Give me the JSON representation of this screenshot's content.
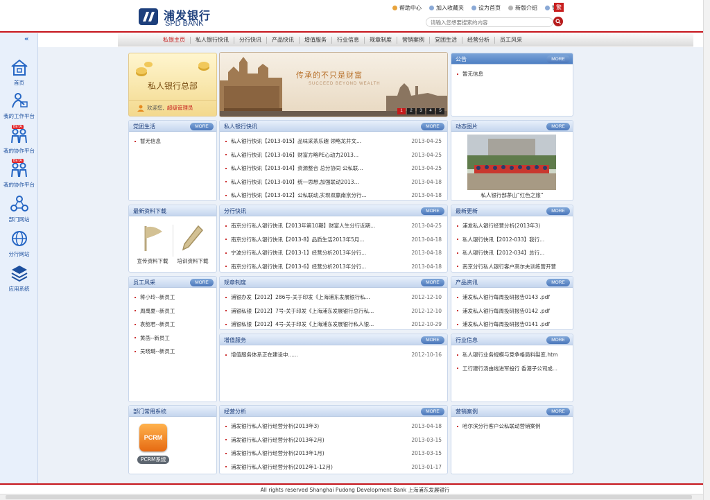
{
  "header": {
    "logo_cn": "浦发银行",
    "logo_en": "SPD BANK",
    "links": [
      "帮助中心",
      "加入收藏夹",
      "设为首页",
      "新版介绍",
      "管理"
    ],
    "lang_toggle": "繁",
    "search_placeholder": "请输入您想要搜索的内容"
  },
  "nav": {
    "items": [
      "私银主页",
      "私人银行快讯",
      "分行快讯",
      "产品快讯",
      "增值服务",
      "行业信息",
      "规章制度",
      "营销案例",
      "党团生活",
      "经营分析",
      "员工风采"
    ],
    "active": "私银主页"
  },
  "sidebar": {
    "items": [
      {
        "label": "首页",
        "icon": "home-icon"
      },
      {
        "label": "我的工作平台",
        "icon": "workspace-icon"
      },
      {
        "label": "我的协作平台",
        "icon": "collab-icon",
        "badge": "BETA"
      },
      {
        "label": "我的协作平台",
        "icon": "collab-icon",
        "badge": "BETA"
      },
      {
        "label": "部门网站",
        "icon": "network-icon"
      },
      {
        "label": "分行网站",
        "icon": "globe-icon"
      },
      {
        "label": "应用系统",
        "icon": "layers-icon"
      }
    ]
  },
  "welcome": {
    "title": "私人银行总部",
    "greeting": "欢迎您,",
    "user": "超级管理员"
  },
  "banner": {
    "slogan": "传承的不只是财富",
    "slogan_en": "SUCCEED  BEYOND  WEALTH",
    "pages": [
      "1",
      "2",
      "3",
      "4",
      "5"
    ],
    "active_page": "1"
  },
  "more_label": "MORE",
  "announcements": {
    "title": "公告",
    "items": [
      "暂无信息"
    ]
  },
  "party": {
    "title": "党团生活",
    "items": [
      "暂无信息"
    ]
  },
  "private_news": {
    "title": "私人银行快讯",
    "items": [
      {
        "text": "私人银行快讯【2013-015】品味采茶乐趣 领略龙井文...",
        "date": "2013-04-25"
      },
      {
        "text": "私人银行快讯【2013-016】财富方略PE心动力2013...",
        "date": "2013-04-25"
      },
      {
        "text": "私人银行快讯【2013-014】资源整合 总分协同 公私联...",
        "date": "2013-04-25"
      },
      {
        "text": "私人银行快讯【2013-010】统一思想,加强联动2013...",
        "date": "2013-04-18"
      },
      {
        "text": "私人银行快讯【2013-012】公私联动,实现双赢南京分行...",
        "date": "2013-04-18"
      }
    ]
  },
  "photos": {
    "title": "动态图片",
    "caption": "私人银行部茅山“红色之旅”"
  },
  "downloads": {
    "title": "最新资料下载",
    "items": [
      "宣传资料下载",
      "培训资料下载"
    ]
  },
  "branch_news": {
    "title": "分行快讯",
    "items": [
      {
        "text": "南京分行私人银行快讯【2013年第10期】财富人生分行近期...",
        "date": "2013-04-25"
      },
      {
        "text": "南京分行私人银行快讯【2013-8】品质生活2013年5月...",
        "date": "2013-04-18"
      },
      {
        "text": "宁波分行私人银行快讯【2013-1】经营分析2013年分行...",
        "date": "2013-04-18"
      },
      {
        "text": "南京分行私人银行快讯【2013-6】经营分析2013年分行...",
        "date": "2013-04-18"
      }
    ]
  },
  "updates": {
    "title": "最新更新",
    "items": [
      "浦发私人银行经营分析(2013年3)",
      "私人银行快讯【2012-033】我行...",
      "私人银行快讯【2012-034】总行...",
      "南京分行私人银行客户高尔夫训练营开营"
    ]
  },
  "staff": {
    "title": "员工风采",
    "items": [
      "蒋小玲--新员工",
      "周禹夏--新员工",
      "袁韶君--新员工",
      "黄菡--新员工",
      "吴晓璐--新员工"
    ]
  },
  "rules": {
    "title": "规章制度",
    "items": [
      {
        "text": "浦银办发【2012】286号-关于印发《上海浦东发展银行私...",
        "date": "2012-12-10"
      },
      {
        "text": "浦银私银【2012】7号-关于印发《上海浦东发展银行总行私...",
        "date": "2012-12-10"
      },
      {
        "text": "浦银私银【2012】4号-关于印发《上海浦东发展银行私人银...",
        "date": "2012-10-29"
      }
    ]
  },
  "products": {
    "title": "产品资讯",
    "items": [
      "浦发私人银行每周投研报告0143 .pdf",
      "浦发私人银行每周投研报告0142 .pdf",
      "浦发私人银行每周投研报告0141 .pdf"
    ]
  },
  "services": {
    "title": "增值服务",
    "items": [
      {
        "text": "增值服务体系正在建设中......",
        "date": "2012-10-16"
      }
    ]
  },
  "industry": {
    "title": "行业信息",
    "items": [
      "私人银行业务规模与竞争格局料裂变.htm",
      "工行建行汤由线进军投行 香港子公司成..."
    ]
  },
  "dept_systems": {
    "title": "部门常用系统",
    "app_icon": "PCRM",
    "app_label": "PCRM系统"
  },
  "analysis": {
    "title": "经营分析",
    "items": [
      {
        "text": "浦发银行私人银行经营分析(2013年3)",
        "date": "2013-04-18"
      },
      {
        "text": "浦发银行私人银行经营分析(2013年2月)",
        "date": "2013-03-15"
      },
      {
        "text": "浦发银行私人银行经营分析(2013年1月)",
        "date": "2013-03-15"
      },
      {
        "text": "浦发银行私人银行经营分析(2012年1-12月)",
        "date": "2013-01-17"
      }
    ]
  },
  "cases": {
    "title": "营销案例",
    "items": [
      "哈尔滨分行客户公私联动营销案例"
    ]
  },
  "footer": {
    "text": "All rights reserved Shanghai Pudong Development Bank 上海浦东发展银行"
  }
}
